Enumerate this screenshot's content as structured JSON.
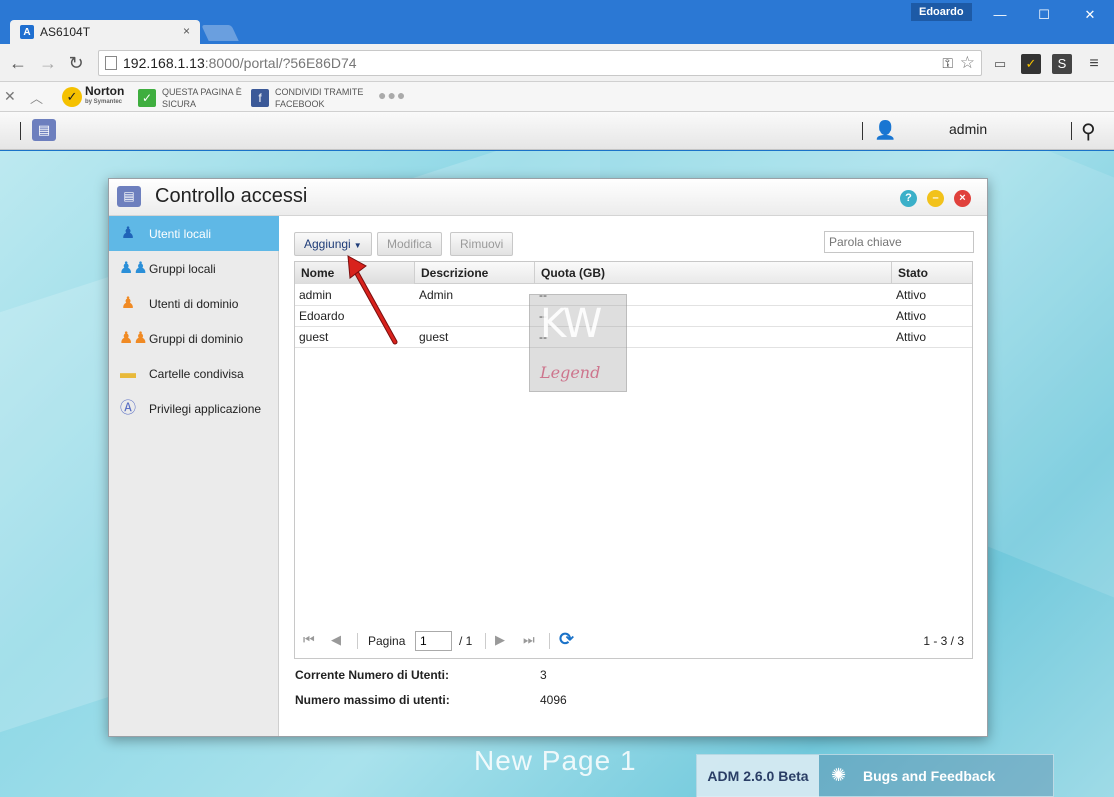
{
  "browser": {
    "tab_title": "AS6104T",
    "tab_close": "×",
    "user_badge": "Edoardo",
    "url_host": "192.168.1.13",
    "url_rest": ":8000/portal/?56E86D74",
    "window_controls": {
      "minimize": "—",
      "maximize": "☐",
      "close": "✕"
    },
    "ext_norton": "Norton",
    "ext_norton_sub": "by Symantec",
    "ext_safe_line1": "QUESTA PAGINA È",
    "ext_safe_line2": "SICURA",
    "ext_fb_line1": "CONDIVIDI TRAMITE",
    "ext_fb_line2": "FACEBOOK",
    "ext_dots": "●●●"
  },
  "adm_bar": {
    "username": "admin"
  },
  "window": {
    "title": "Controllo accessi",
    "sidebar": [
      {
        "label": "Utenti locali",
        "icon": "person-icon",
        "color": "#2a8fd8",
        "active": true
      },
      {
        "label": "Gruppi locali",
        "icon": "group-icon",
        "color": "#2a8fd8"
      },
      {
        "label": "Utenti di dominio",
        "icon": "domain-user-icon",
        "color": "#f08a24"
      },
      {
        "label": "Gruppi di dominio",
        "icon": "domain-group-icon",
        "color": "#f08a24"
      },
      {
        "label": "Cartelle condivisa",
        "icon": "folder-icon",
        "color": "#e8b93a"
      },
      {
        "label": "Privilegi applicazione",
        "icon": "app-privilege-icon",
        "color": "#5a6fc4"
      }
    ],
    "toolbar": {
      "add_label": "Aggiungi",
      "edit_label": "Modifica",
      "remove_label": "Rimuovi",
      "search_placeholder": "Parola chiave"
    },
    "table": {
      "headers": {
        "name": "Nome",
        "desc": "Descrizione",
        "quota": "Quota (GB)",
        "status": "Stato"
      },
      "rows": [
        {
          "name": "admin",
          "desc": "Admin",
          "quota": "--",
          "status": "Attivo"
        },
        {
          "name": "Edoardo",
          "desc": "",
          "quota": "--",
          "status": "Attivo"
        },
        {
          "name": "guest",
          "desc": "guest",
          "quota": "--",
          "status": "Attivo"
        }
      ]
    },
    "pager": {
      "page_label": "Pagina",
      "page_value": "1",
      "page_total": "/ 1",
      "range": "1 - 3 / 3"
    },
    "stats": {
      "current_label": "Corrente Numero di Utenti:",
      "current_value": "3",
      "max_label": "Numero massimo di utenti:",
      "max_value": "4096"
    }
  },
  "watermark": {
    "top": "KW",
    "bottom": "Legend"
  },
  "desktop": {
    "page_name": "New Page 1",
    "version": "ADM 2.6.0 Beta",
    "bugs_label": "Bugs and Feedback"
  }
}
